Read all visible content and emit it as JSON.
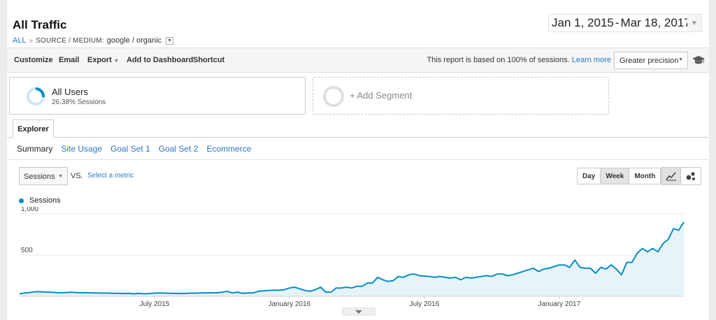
{
  "header": {
    "title": "All Traffic",
    "breadcrumb_root": "ALL",
    "breadcrumb_sep": "»",
    "breadcrumb_dimension": "SOURCE / MEDIUM:",
    "breadcrumb_value": "google / organic"
  },
  "date_range": {
    "start": "Jan 1, 2015",
    "separator": "-",
    "end": "Mar 18, 2017"
  },
  "toolbar": {
    "customize": "Customize",
    "email": "Email",
    "export": "Export",
    "add_to_dashboard": "Add to Dashboard",
    "shortcut": "Shortcut",
    "sampling_note": "This report is based on 100% of sessions.",
    "learn_more": "Learn more",
    "precision": "Greater precision"
  },
  "segments": {
    "active_name": "All Users",
    "active_sub": "26.38% Sessions",
    "active_fraction": 0.2638,
    "add_label": "+ Add Segment"
  },
  "tabs": {
    "explorer": "Explorer",
    "subtabs": [
      "Summary",
      "Site Usage",
      "Goal Set 1",
      "Goal Set 2",
      "Ecommerce"
    ]
  },
  "metric": {
    "selected": "Sessions",
    "vs": "VS.",
    "select_metric": "Select a metric"
  },
  "period": {
    "options": [
      "Day",
      "Week",
      "Month"
    ],
    "selected": "Week"
  },
  "colors": {
    "series": "#058dc7",
    "fill": "#e6f4fa",
    "link": "#2b79c2"
  },
  "chart_data": {
    "type": "area",
    "title": "",
    "xlabel": "",
    "ylabel": "",
    "series": [
      {
        "name": "Sessions"
      }
    ],
    "ylim": [
      0,
      1000
    ],
    "yticks": [
      "1,000",
      "500"
    ],
    "ytick_values": [
      1000,
      500
    ],
    "grid": true,
    "x_tick_labels": [
      "July 2015",
      "January 2016",
      "July 2016",
      "January 2017"
    ],
    "x_tick_weeks": [
      26,
      52,
      78,
      104
    ],
    "values": [
      30,
      40,
      45,
      55,
      55,
      50,
      50,
      45,
      42,
      45,
      48,
      45,
      42,
      42,
      40,
      40,
      38,
      38,
      36,
      35,
      33,
      35,
      30,
      35,
      30,
      33,
      38,
      40,
      38,
      36,
      35,
      33,
      35,
      38,
      38,
      40,
      40,
      42,
      42,
      48,
      60,
      40,
      50,
      35,
      40,
      40,
      60,
      65,
      70,
      75,
      72,
      80,
      100,
      110,
      90,
      70,
      60,
      80,
      110,
      50,
      50,
      100,
      100,
      110,
      100,
      120,
      120,
      160,
      160,
      230,
      200,
      180,
      190,
      240,
      230,
      260,
      270,
      250,
      245,
      240,
      230,
      240,
      230,
      220,
      230,
      200,
      230,
      220,
      230,
      240,
      250,
      240,
      270,
      270,
      250,
      260,
      280,
      300,
      320,
      340,
      300,
      330,
      340,
      360,
      380,
      380,
      350,
      440,
      350,
      340,
      340,
      280,
      350,
      330,
      380,
      330,
      260,
      410,
      410,
      520,
      580,
      540,
      580,
      540,
      640,
      690,
      820,
      800,
      900
    ]
  }
}
